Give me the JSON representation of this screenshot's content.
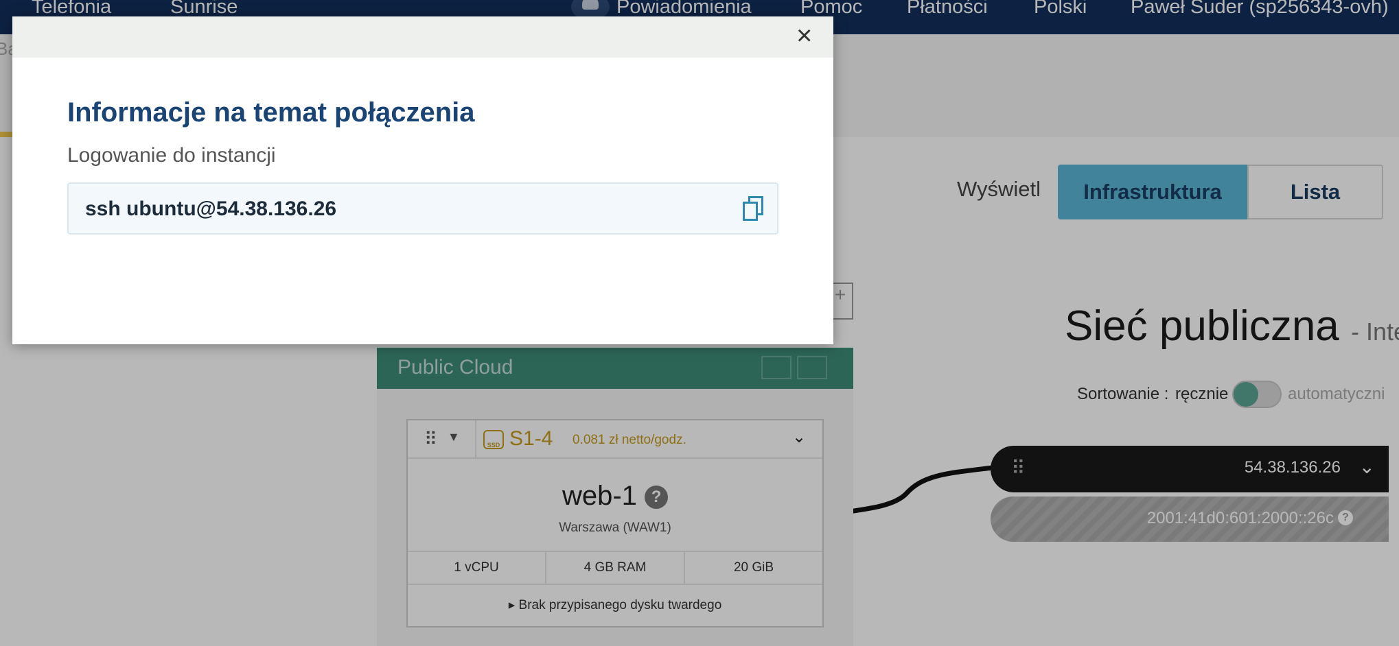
{
  "nav": {
    "telephony": "Telefonia",
    "sunrise": "Sunrise",
    "notifications": "Powiadomienia",
    "help": "Pomoc",
    "payments": "Płatności",
    "language": "Polski",
    "user": "Paweł Suder (sp256343-ovh)"
  },
  "page": {
    "breadcrumb_partial": "Ba",
    "view_label": "Wyświetl",
    "view_infra": "Infrastruktura",
    "view_list": "Lista",
    "network_title": "Sieć publiczna",
    "network_subtitle": "- Inte",
    "sort_label": "Sortowanie :",
    "sort_manual": "ręcznie",
    "sort_auto": "automatyczni",
    "ip4": "54.38.136.26",
    "ip6": "2001:41d0:601:2000::26c",
    "public_cloud": "Public Cloud",
    "add_symbol": "+"
  },
  "instance": {
    "ssd_badge": "SSD",
    "flavor": "S1-4",
    "price": "0.081 zł netto/godz.",
    "name": "web-1",
    "help_mark": "?",
    "region": "Warszawa (WAW1)",
    "specs": [
      "1 vCPU",
      "4 GB RAM",
      "20 GiB"
    ],
    "disk": "Brak przypisanego dysku twardego"
  },
  "modal": {
    "close_symbol": "×",
    "title": "Informacje na temat połączenia",
    "subtitle": "Logowanie do instancji",
    "command": "ssh ubuntu@54.38.136.26"
  },
  "colors": {
    "nav_bg": "#122e5c",
    "accent_blue": "#5ab6d4",
    "public_cloud_green": "#3d8c78",
    "flavor_gold": "#c59a1c",
    "title_blue": "#1a4474"
  }
}
